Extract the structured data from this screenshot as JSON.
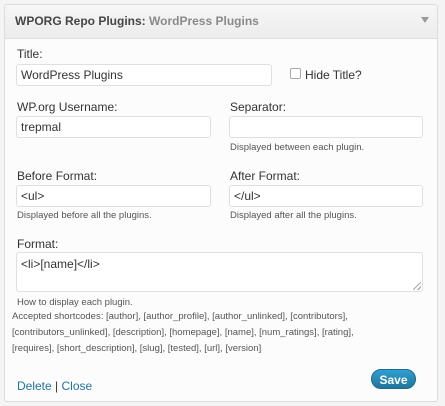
{
  "widget": {
    "title_plugin": "WPORG Repo Plugins",
    "title_separator": ":",
    "title_instance": "WordPress Plugins"
  },
  "form": {
    "title_label": "Title:",
    "title_value": "WordPress Plugins",
    "hide_title_label": "Hide Title?",
    "hide_title_checked": false,
    "username_label": "WP.org Username:",
    "username_value": "trepmal",
    "separator_label": "Separator:",
    "separator_value": "",
    "separator_help": "Displayed between each plugin.",
    "before_label": "Before Format:",
    "before_value": "<ul>",
    "before_help": "Displayed before all the plugins.",
    "after_label": "After Format:",
    "after_value": "</ul>",
    "after_help": "Displayed after all the plugins.",
    "format_label": "Format:",
    "format_value": "<li>[name]</li>",
    "format_help": "How to display each plugin.",
    "shortcodes_line1": "Accepted shortcodes: [author], [author_profile], [author_unlinked], [contributors],",
    "shortcodes_line2": "[contributors_unlinked], [description], [homepage], [name], [num_ratings], [rating],",
    "shortcodes_line3": "[requires], [short_description], [slug], [tested], [url], [version]"
  },
  "footer": {
    "delete_label": "Delete",
    "separator": "|",
    "close_label": "Close",
    "save_label": "Save"
  },
  "icons": {
    "toggle": "chevron-down-icon",
    "resize": "resize-grip-icon"
  },
  "colors": {
    "link": "#21759b",
    "save_button": "#21759b"
  }
}
